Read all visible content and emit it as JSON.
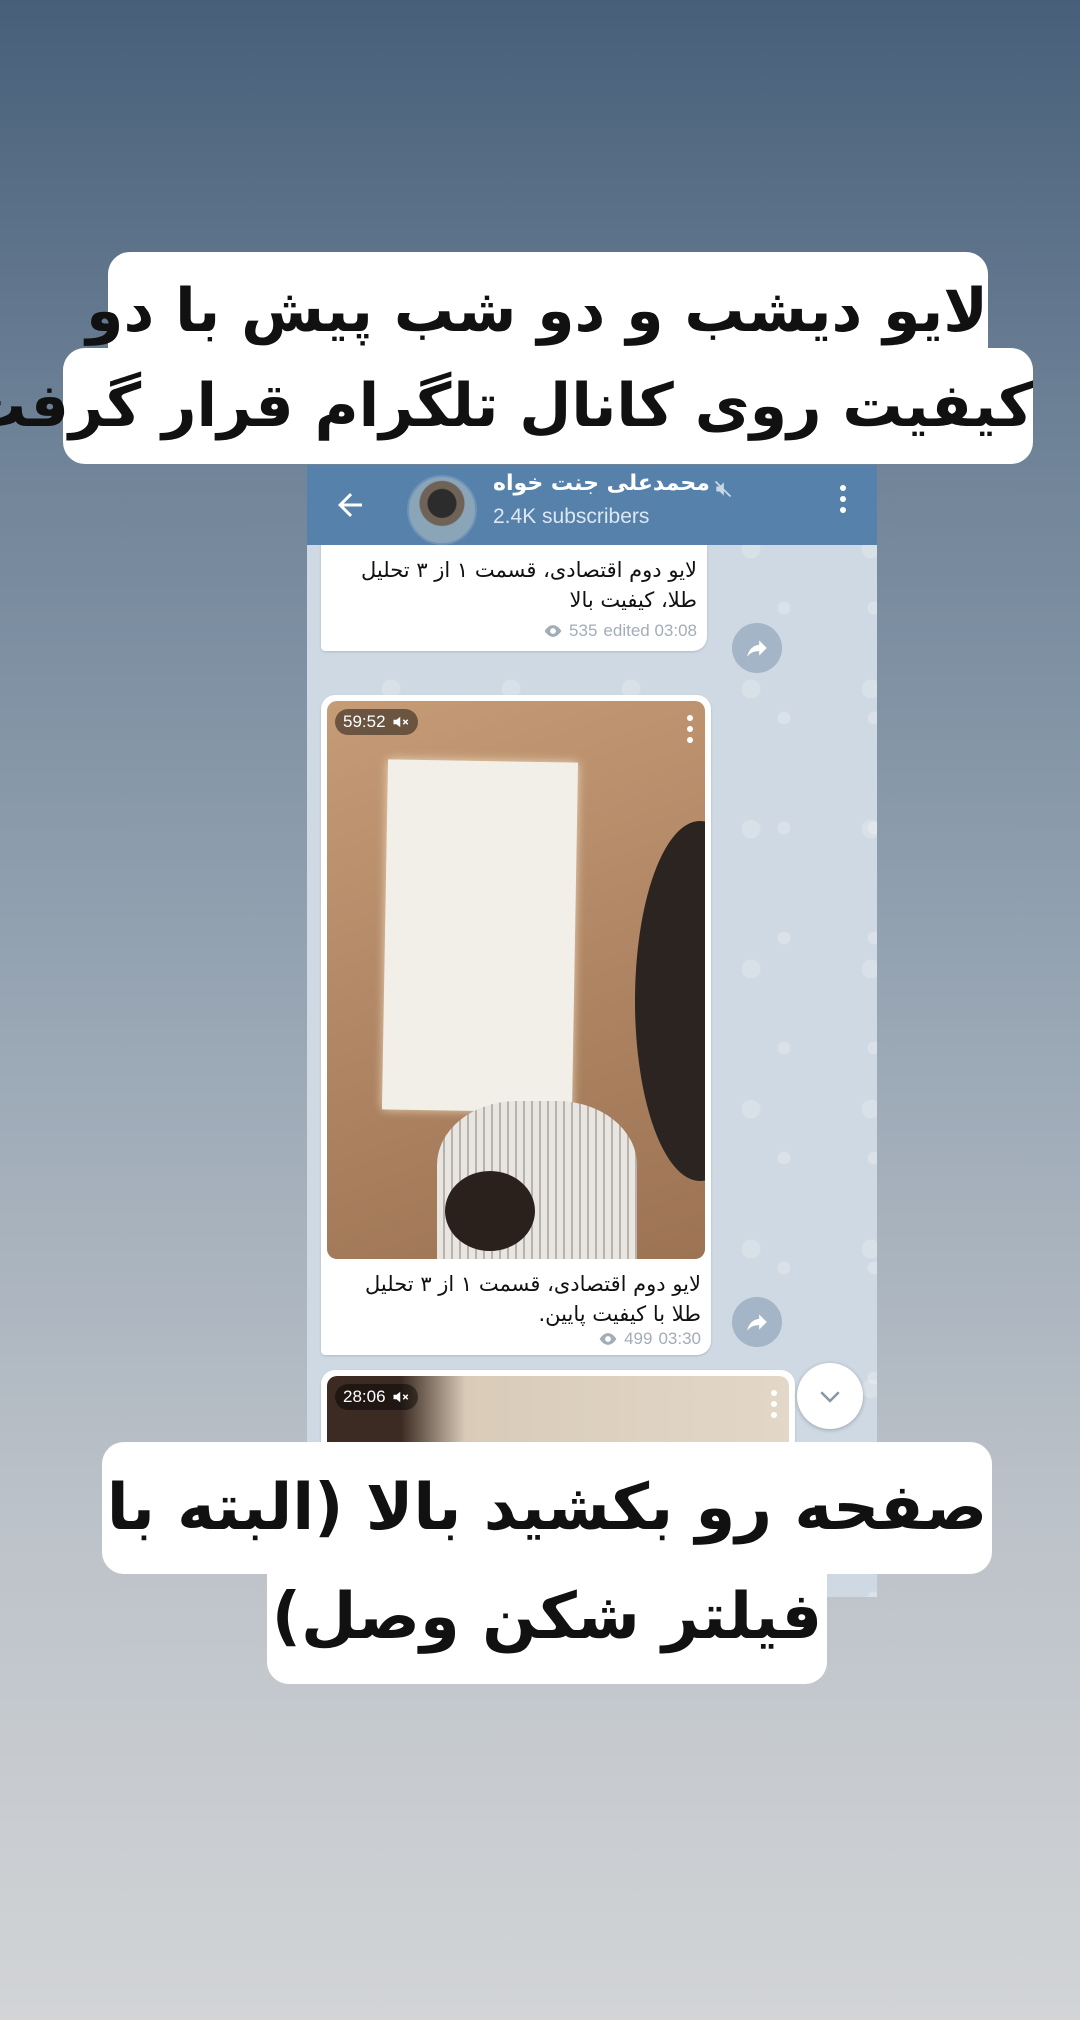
{
  "captions": {
    "top_line1": "لایو دیشب و دو شب پیش با دو",
    "top_line2": "کیفیت روی کانال تلگرام قرار گرفت",
    "bottom_line1": "صفحه رو بکشید بالا (البته با",
    "bottom_line2": "فیلتر شکن وصل)"
  },
  "header": {
    "channel_name": "محمدعلی جنت خواه",
    "subscribers": "2.4K subscribers",
    "color": "#5681ab"
  },
  "messages": [
    {
      "caption_line1": "لایو دوم اقتصادی، قسمت ۱ از ۳ تحلیل",
      "caption_line2": "طلا، کیفیت بالا",
      "views": "535",
      "time": "edited 03:08"
    },
    {
      "duration": "59:52",
      "caption_line1": "لایو دوم اقتصادی، قسمت ۱ از ۳ تحلیل",
      "caption_line2": "طلا با کیفیت پایین.",
      "views": "499",
      "time": "03:30"
    },
    {
      "duration": "28:06"
    }
  ],
  "icons": [
    "back-arrow-icon",
    "mute-icon",
    "more-vertical-icon",
    "eye-icon",
    "share-icon",
    "volume-muted-icon",
    "chevron-down-icon"
  ]
}
